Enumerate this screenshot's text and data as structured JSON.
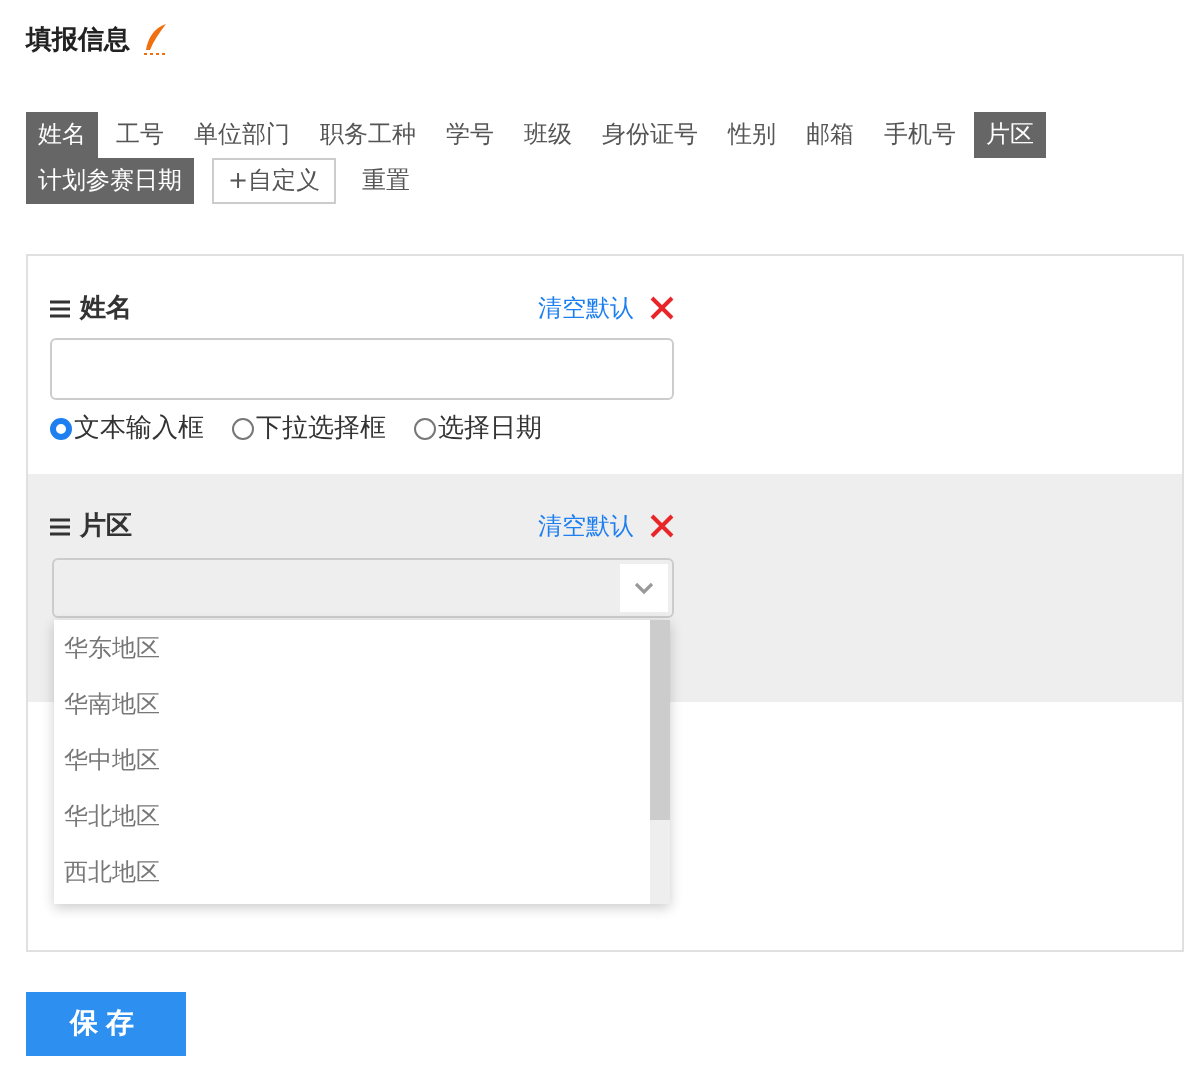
{
  "header": {
    "title": "填报信息"
  },
  "field_tags": [
    {
      "label": "姓名",
      "selected": true
    },
    {
      "label": "工号",
      "selected": false
    },
    {
      "label": "单位部门",
      "selected": false
    },
    {
      "label": "职务工种",
      "selected": false
    },
    {
      "label": "学号",
      "selected": false
    },
    {
      "label": "班级",
      "selected": false
    },
    {
      "label": "身份证号",
      "selected": false
    },
    {
      "label": "性别",
      "selected": false
    },
    {
      "label": "邮箱",
      "selected": false
    },
    {
      "label": "手机号",
      "selected": false
    },
    {
      "label": "片区",
      "selected": true
    },
    {
      "label": "计划参赛日期",
      "selected": true
    }
  ],
  "tag_actions": [
    {
      "kind": "add",
      "label": "+自定义"
    },
    {
      "kind": "reset",
      "label": "重置"
    }
  ],
  "fields": [
    {
      "kind": "text",
      "label": "姓名",
      "highlighted": false,
      "clear_link": "清空默认",
      "input_types": [
        {
          "label": "文本输入框",
          "selected": true
        },
        {
          "label": "下拉选择框",
          "selected": false
        },
        {
          "label": "选择日期",
          "selected": false
        }
      ]
    },
    {
      "kind": "select",
      "label": "片区",
      "highlighted": true,
      "clear_link": "清空默认",
      "dropdown": {
        "options": [
          "华东地区",
          "华南地区",
          "华中地区",
          "华北地区",
          "西北地区"
        ]
      }
    }
  ],
  "save_button": "保存"
}
